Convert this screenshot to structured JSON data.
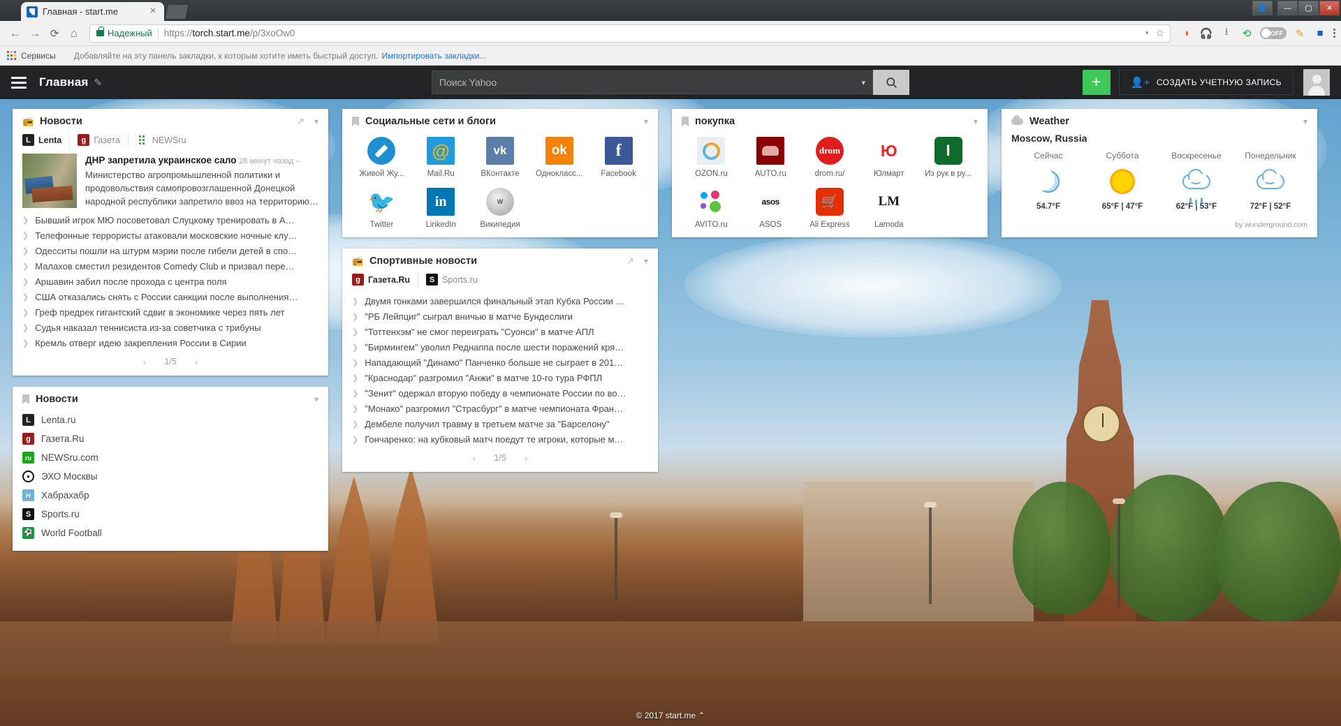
{
  "browser": {
    "tab": {
      "title": "Главная - start.me",
      "favicon": "startme-favicon",
      "close": "×"
    },
    "nav": {
      "back": "←",
      "forward": "→",
      "reload": "⟳",
      "home": "⌂"
    },
    "omnibox": {
      "secure_label": "Надежный",
      "url_protocol": "https://",
      "url_host": "torch.start.me",
      "url_path": "/p/3xoOw0",
      "dropdown_caret": "▾",
      "bookmark_star": "☆"
    },
    "extensions": [
      "shield-icon",
      "headphones-icon",
      "download-icon",
      "power-icon",
      "off-toggle",
      "highlighter-icon",
      "startme-icon",
      "menu-kebab-icon"
    ],
    "toggle_label": "OFF",
    "bookmarks_bar": {
      "apps_label": "Сервисы",
      "hint": "Добавляйте на эту панель закладки, к которым хотите иметь быстрый доступ.",
      "import_link": "Импортировать закладки..."
    },
    "window_controls": {
      "user": "user-icon",
      "minimize": "—",
      "maximize": "▢",
      "close": "✕"
    }
  },
  "header": {
    "menu_icon": "hamburger-icon",
    "page_title": "Главная",
    "edit_icon": "pencil-icon",
    "search": {
      "placeholder": "Поиск Yahoo",
      "value": "",
      "caret": "▾",
      "button_icon": "search-icon"
    },
    "add_button": "+",
    "create_account": "СОЗДАТЬ УЧЕТНУЮ ЗАПИСЬ",
    "avatar": "user-avatar"
  },
  "footer": {
    "copyright": "© 2017 start.me",
    "collapse_arrow": "⌃"
  },
  "widgets": {
    "news_feed": {
      "title": "Новости",
      "icon": "rss-icon",
      "sources": [
        {
          "label": "Lenta",
          "favicon": "lenta-favicon",
          "active": true
        },
        {
          "label": "Газета",
          "favicon": "gazeta-favicon",
          "active": false
        },
        {
          "label": "NEWSru",
          "favicon": "newsru-favicon",
          "active": false
        }
      ],
      "feature": {
        "title": "ДНР запретила украинское сало",
        "time": "28 минут назад –",
        "body": "Министерство агропромышленной политики и продовольствия самопровозглашенной Донецкой народной республики запретило ввоз на территорию…"
      },
      "items": [
        "Бывший игрок МЮ посоветовал Слуцкому тренировать в А…",
        "Телефонные террористы атаковали московские ночные клу…",
        "Одесситы пошли на штурм мэрии после гибели детей в спо…",
        "Малахов сместил резидентов Comedy Club и призвал пере…",
        "Аршавин забил после прохода с центра поля",
        "США отказались снять с России санкции после выполнения…",
        "Греф предрек гигантский сдвиг в экономике через пять лет",
        "Судья наказал теннисиста из-за советчика с трибуны",
        "Кремль отверг идею закрепления России в Сирии"
      ],
      "pager": {
        "prev": "‹",
        "label": "1/5",
        "next": "›"
      }
    },
    "news_links": {
      "title": "Новости",
      "icon": "bookmark-icon",
      "items": [
        {
          "label": "Lenta.ru",
          "favicon": "lenta-favicon"
        },
        {
          "label": "Газета.Ru",
          "favicon": "gazeta-favicon"
        },
        {
          "label": "NEWSru.com",
          "favicon": "newsru-favicon"
        },
        {
          "label": "ЭХО Москвы",
          "favicon": "echo-favicon"
        },
        {
          "label": "Хабрахабр",
          "favicon": "habr-favicon"
        },
        {
          "label": "Sports.ru",
          "favicon": "sports-favicon"
        },
        {
          "label": "World Football",
          "favicon": "worldfootball-favicon"
        }
      ]
    },
    "social": {
      "title": "Социальные сети и блоги",
      "icon": "bookmark-icon",
      "tiles": [
        {
          "label": "Живой Жу...",
          "icon": "livejournal-icon"
        },
        {
          "label": "Mail.Ru",
          "icon": "mailru-icon"
        },
        {
          "label": "ВКонтакте",
          "icon": "vk-icon"
        },
        {
          "label": "Однокласс...",
          "icon": "odnoklassniki-icon"
        },
        {
          "label": "Facebook",
          "icon": "facebook-icon"
        },
        {
          "label": "Twitter",
          "icon": "twitter-icon"
        },
        {
          "label": "LinkedIn",
          "icon": "linkedin-icon"
        },
        {
          "label": "Википедия",
          "icon": "wikipedia-icon"
        }
      ]
    },
    "shopping": {
      "title": "покупка",
      "icon": "bookmark-icon",
      "tiles": [
        {
          "label": "OZON.ru",
          "icon": "ozon-icon"
        },
        {
          "label": "AUTO.ru",
          "icon": "autoru-icon"
        },
        {
          "label": "drom.ru/",
          "icon": "drom-icon"
        },
        {
          "label": "Юлмарт",
          "icon": "ulmart-icon"
        },
        {
          "label": "Из рук в ру...",
          "icon": "izrukvruki-icon"
        },
        {
          "label": "AVITO.ru",
          "icon": "avito-icon"
        },
        {
          "label": "ASOS",
          "icon": "asos-icon"
        },
        {
          "label": "Ali Express",
          "icon": "aliexpress-icon"
        },
        {
          "label": "Lamoda",
          "icon": "lamoda-icon"
        }
      ]
    },
    "sports_feed": {
      "title": "Спортивные новости",
      "icon": "rss-icon",
      "sources": [
        {
          "label": "Газета.Ru",
          "favicon": "gazeta-favicon",
          "active": true
        },
        {
          "label": "Sports.ru",
          "favicon": "sports-favicon",
          "active": false
        }
      ],
      "items": [
        "Двумя гонками завершился финальный этап Кубка России …",
        "\"РБ Лейпциг\" сыграл вничью в матче Бундеслиги",
        "\"Тоттенхэм\" не смог переиграть \"Суонси\" в матче АПЛ",
        "\"Бирмингем\" уволил Реднаппа после шести поражений кря…",
        "Нападающий \"Динамо\" Панченко больше не сыграет в 201…",
        "\"Краснодар\" разгромил \"Анжи\" в матче 10-го тура РФПЛ",
        "\"Зенит\" одержал вторую победу в чемпионате России по во…",
        "\"Монако\" разгромил \"Страсбург\" в матче чемпионата Фран…",
        "Дембеле получил травму в третьем матче за \"Барселону\"",
        "Гончаренко: на кубковый матч поедут те игроки, которые м…"
      ],
      "pager": {
        "prev": "‹",
        "label": "1/5",
        "next": "›"
      }
    },
    "weather": {
      "title": "Weather",
      "icon": "cloud-icon",
      "city": "Moscow, Russia",
      "credit": "by wunderground.com",
      "days": [
        {
          "name": "Сейчас",
          "icon": "moon-icon",
          "temp": "54.7°F"
        },
        {
          "name": "Суббота",
          "icon": "sun-icon",
          "temp": "65°F | 47°F"
        },
        {
          "name": "Воскресенье",
          "icon": "rain-cloud-icon",
          "temp": "62°F | 53°F"
        },
        {
          "name": "Понедельник",
          "icon": "sun-cloud-icon",
          "temp": "72°F | 52°F"
        }
      ]
    }
  },
  "colors": {
    "header_bg": "#222325",
    "accent_green": "#3cc758",
    "link_blue": "#1a73e8",
    "secure_green": "#0b8043"
  }
}
